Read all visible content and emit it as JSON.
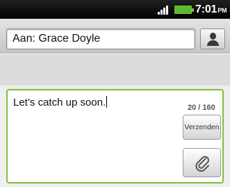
{
  "status_bar": {
    "time": "7:01",
    "ampm": "PM",
    "battery_color": "#5cb82b",
    "icons": [
      "signal-icon",
      "battery-icon"
    ]
  },
  "recipient": {
    "to_value": "Aan: Grace Doyle",
    "contact_icon": "person-icon"
  },
  "compose": {
    "message": "Let’s catch up soon.",
    "char_count": "20 / 160",
    "send_label": "Verzenden",
    "attach_icon": "paperclip-icon",
    "accent_color": "#7fbf3a"
  }
}
